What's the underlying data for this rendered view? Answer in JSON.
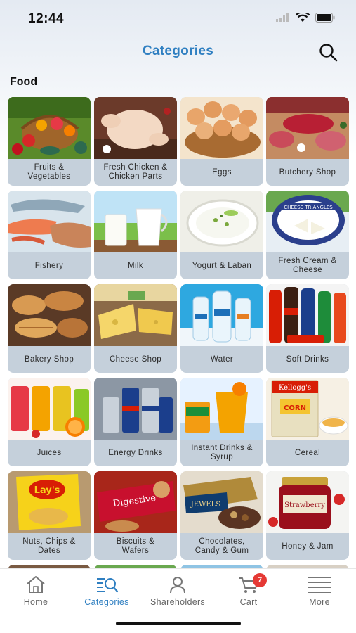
{
  "status_bar": {
    "time": "12:44"
  },
  "header": {
    "title": "Categories"
  },
  "section": {
    "title": "Food"
  },
  "categories": [
    {
      "label": "Fruits &\nVegetables",
      "icon": "fruits-vegetables-image"
    },
    {
      "label": "Fresh Chicken &\nChicken Parts",
      "icon": "chicken-image"
    },
    {
      "label": "Eggs",
      "icon": "eggs-image"
    },
    {
      "label": "Butchery Shop",
      "icon": "butchery-image"
    },
    {
      "label": "Fishery",
      "icon": "fishery-image"
    },
    {
      "label": "Milk",
      "icon": "milk-image"
    },
    {
      "label": "Yogurt & Laban",
      "icon": "yogurt-image"
    },
    {
      "label": "Fresh Cream &\nCheese",
      "icon": "cream-cheese-image"
    },
    {
      "label": "Bakery Shop",
      "icon": "bakery-image"
    },
    {
      "label": "Cheese Shop",
      "icon": "cheese-image"
    },
    {
      "label": "Water",
      "icon": "water-image"
    },
    {
      "label": "Soft Drinks",
      "icon": "soft-drinks-image"
    },
    {
      "label": "Juices",
      "icon": "juices-image"
    },
    {
      "label": "Energy Drinks",
      "icon": "energy-drinks-image"
    },
    {
      "label": "Instant Drinks &\nSyrup",
      "icon": "instant-drinks-image"
    },
    {
      "label": "Cereal",
      "icon": "cereal-image"
    },
    {
      "label": "Nuts, Chips &\nDates",
      "icon": "nuts-chips-image"
    },
    {
      "label": "Biscuits &\nWafers",
      "icon": "biscuits-image"
    },
    {
      "label": "Chocolates,\nCandy & Gum",
      "icon": "chocolates-image"
    },
    {
      "label": "Honey & Jam",
      "icon": "honey-jam-image"
    }
  ],
  "tab_bar": {
    "tabs": [
      {
        "label": "Home",
        "icon": "home-icon"
      },
      {
        "label": "Categories",
        "icon": "categories-icon"
      },
      {
        "label": "Shareholders",
        "icon": "shareholders-icon"
      },
      {
        "label": "Cart",
        "icon": "cart-icon"
      },
      {
        "label": "More",
        "icon": "menu-icon"
      }
    ],
    "cart_badge": "7"
  },
  "colors": {
    "accent": "#2f7fc1",
    "tile_label_bg": "#c5d0db",
    "badge": "#e53935"
  }
}
